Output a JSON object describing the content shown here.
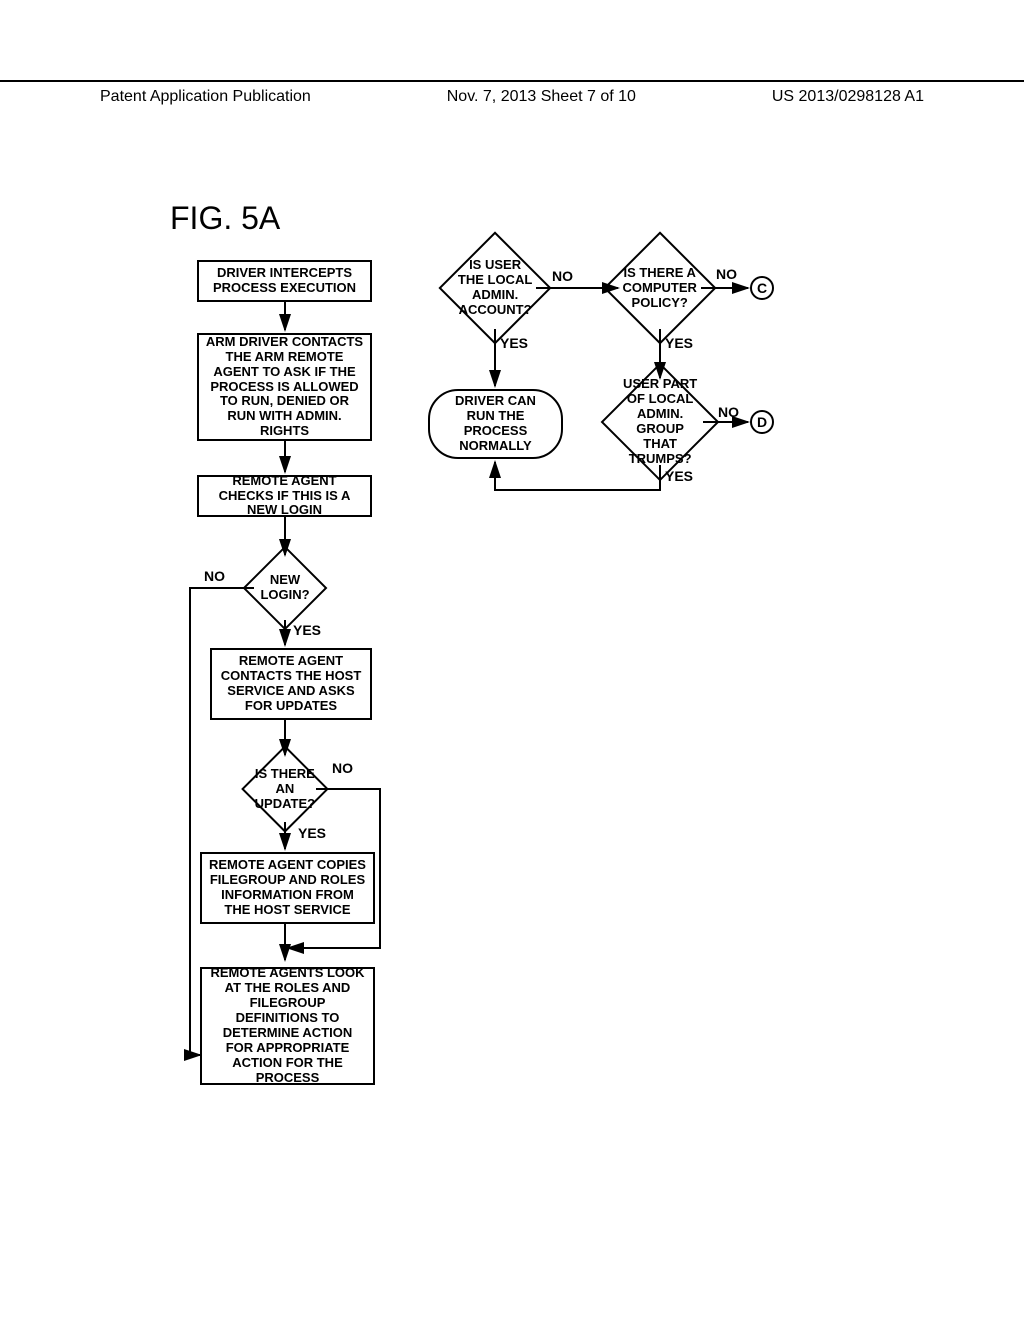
{
  "header": {
    "left": "Patent Application Publication",
    "center": "Nov. 7, 2013  Sheet 7 of 10",
    "right": "US 2013/0298128 A1"
  },
  "figure_label": "FIG. 5A",
  "nodes": {
    "b1": "DRIVER INTERCEPTS PROCESS EXECUTION",
    "b2": "ARM DRIVER CONTACTS THE ARM REMOTE AGENT TO ASK IF THE PROCESS IS ALLOWED TO RUN, DENIED OR RUN WITH ADMIN. RIGHTS",
    "b3": "REMOTE AGENT CHECKS IF THIS IS A NEW LOGIN",
    "d1": "NEW LOGIN?",
    "b4": "REMOTE AGENT CONTACTS THE HOST SERVICE AND ASKS FOR UPDATES",
    "d2": "IS THERE AN UPDATE?",
    "b5": "REMOTE AGENT COPIES FILEGROUP AND ROLES INFORMATION FROM THE HOST SERVICE",
    "b6": "REMOTE AGENTS LOOK AT THE ROLES AND FILEGROUP DEFINITIONS TO DETERMINE ACTION FOR APPROPRIATE ACTION FOR THE PROCESS",
    "d3": "IS USER THE LOCAL ADMIN. ACCOUNT?",
    "r1": "DRIVER CAN RUN THE PROCESS NORMALLY",
    "d4": "IS THERE A COMPUTER POLICY?",
    "d5": "USER PART OF LOCAL ADMIN. GROUP THAT TRUMPS?",
    "cC": "C",
    "cD": "D"
  },
  "labels": {
    "yes": "YES",
    "no": "NO"
  }
}
